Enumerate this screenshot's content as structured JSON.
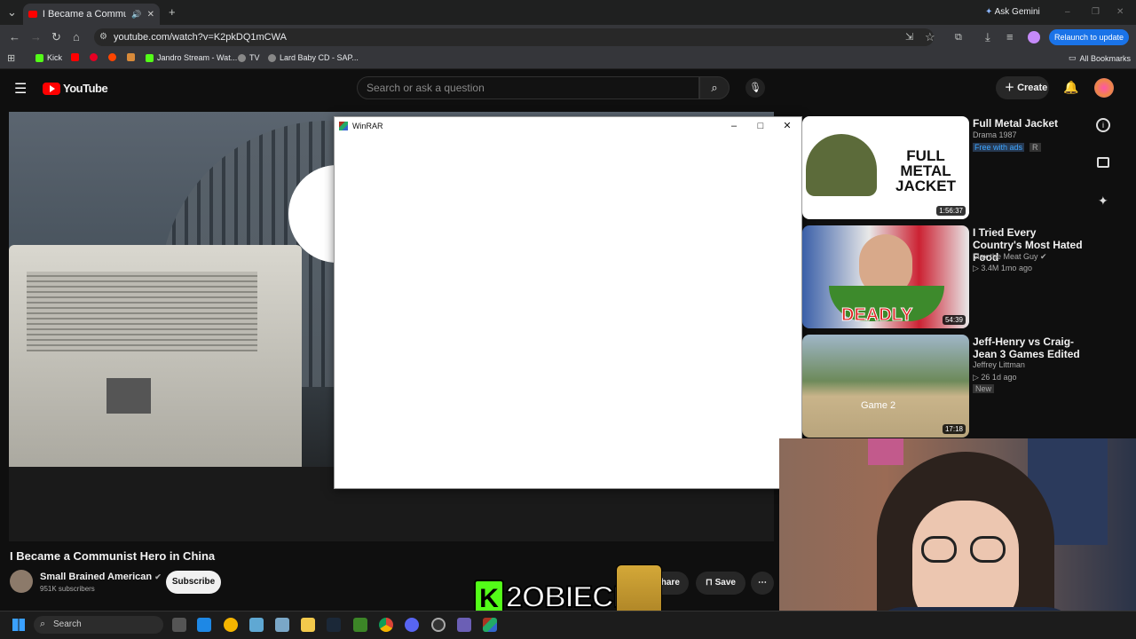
{
  "browser": {
    "tab_title": "I Became a Communist He",
    "url": "youtube.com/watch?v=K2pkDQ1mCWA",
    "ask_gemini": "Ask Gemini",
    "relaunch": "Relaunch to update",
    "bookmarks": [
      {
        "label": "Kick",
        "color": "#53fc18"
      },
      {
        "label": "Jandro Stream - Wat...",
        "color": "#53fc18"
      },
      {
        "label": "TV",
        "color": "#cccccc"
      },
      {
        "label": "Lard Baby CD - SAP...",
        "color": "#cccccc"
      }
    ],
    "all_bookmarks": "All Bookmarks"
  },
  "youtube": {
    "logo": "YouTube",
    "search_placeholder": "Search or ask a question",
    "create": "Create"
  },
  "winrar": {
    "title": "WinRAR",
    "minimize": "–",
    "maximize": "□",
    "close": "✕"
  },
  "video": {
    "title": "I Became a Communist Hero in China",
    "channel": "Small Brained American",
    "subscribers": "951K subscribers",
    "subscribe": "Subscribe",
    "share": "Share",
    "save": "Save",
    "more": "⋯"
  },
  "recommendations": [
    {
      "title": "Full Metal Jacket",
      "meta1": "Drama 1987",
      "meta2": "Free with ads",
      "rating": "R",
      "duration": "1:56:37",
      "thumb_text": "FULL METAL JACKET"
    },
    {
      "title": "I Tried Every Country's Most Hated Food",
      "meta1": "Max the Meat Guy ✔",
      "meta2": "▷ 3.4M  1mo ago",
      "duration": "54:39",
      "thumb_text": "DEADLY"
    },
    {
      "title": "Jeff-Henry vs Craig-Jean 3 Games Edited",
      "meta1": "Jeffrey Littman",
      "meta2": "▷ 26  1d ago",
      "badge": "New",
      "duration": "17:18",
      "thumb_text": "Game 2"
    }
  ],
  "overlay": {
    "kick_letter": "K",
    "name": "2OBIECE"
  },
  "taskbar": {
    "search": "Search"
  }
}
